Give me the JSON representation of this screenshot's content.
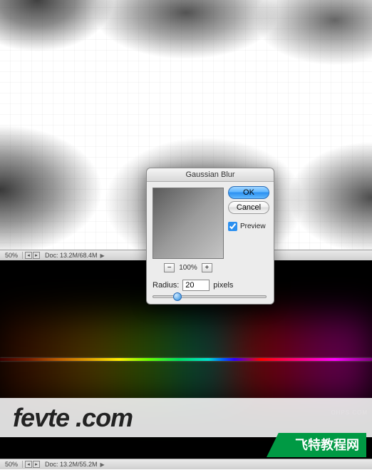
{
  "top_canvas": {
    "zoom": "50%",
    "doc_info": "Doc: 13.2M/68.4M"
  },
  "bottom_canvas": {
    "zoom": "50%",
    "doc_info": "Doc: 13.2M/55.2M"
  },
  "dialog": {
    "title": "Gaussian Blur",
    "ok_label": "OK",
    "cancel_label": "Cancel",
    "preview_label": "Preview",
    "preview_checked": true,
    "zoom_value": "100%",
    "radius_label": "Radius:",
    "radius_value": "20",
    "radius_unit": "pixels",
    "minus": "−",
    "plus": "+"
  },
  "watermark": {
    "main": "fevte .com",
    "sub": "飞特教程网",
    "faint": "OHPS.COM"
  }
}
